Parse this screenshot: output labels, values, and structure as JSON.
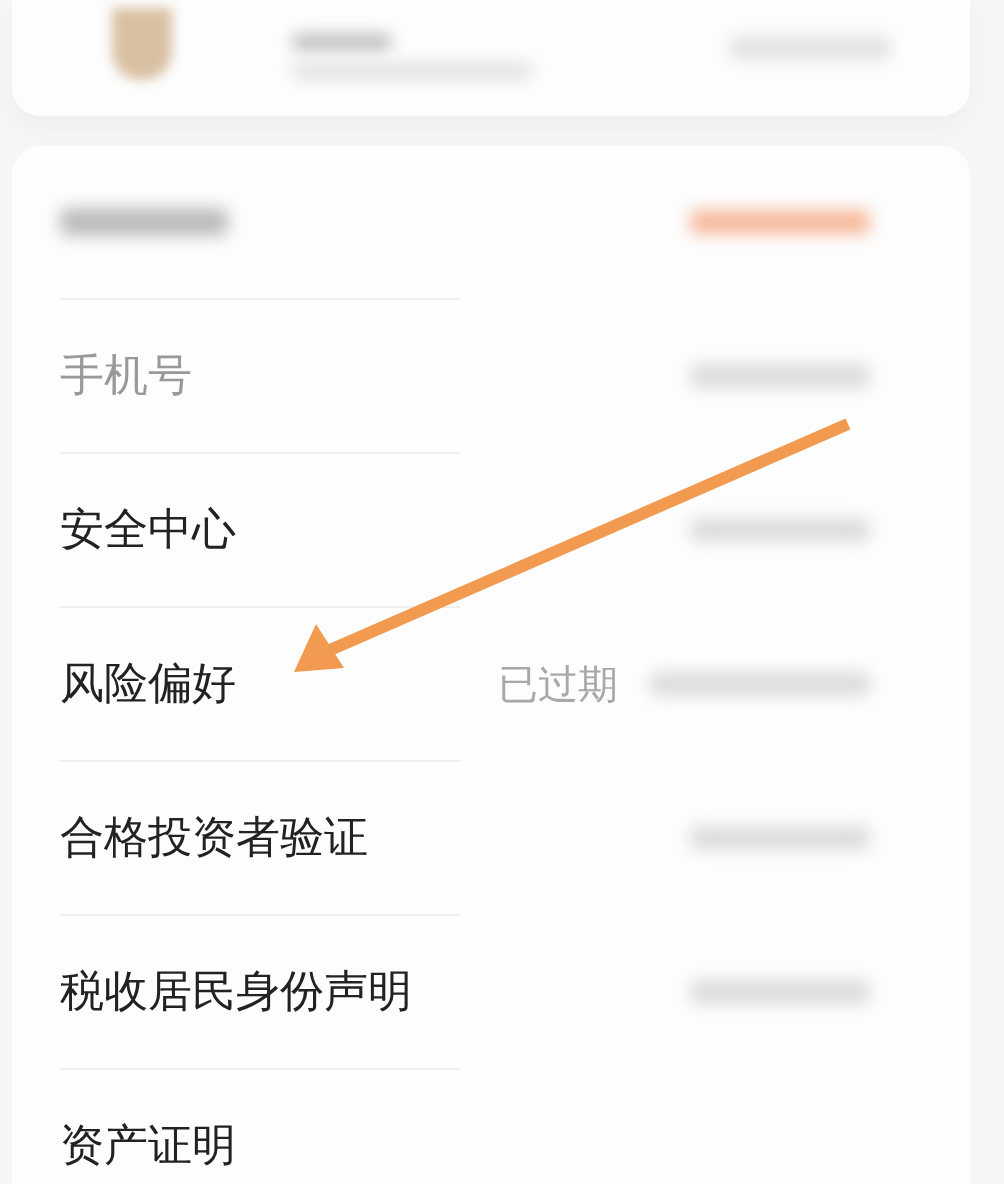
{
  "profile_card": {
    "avatar": true
  },
  "rows": [
    {
      "kind": "blurred",
      "accent": true
    },
    {
      "kind": "text",
      "label": "手机号",
      "blurred": true
    },
    {
      "kind": "text",
      "label": "安全中心",
      "blurred": false
    },
    {
      "kind": "text",
      "label": "风险偏好",
      "blurred": false,
      "status": "已过期"
    },
    {
      "kind": "text",
      "label": "合格投资者验证",
      "blurred": false
    },
    {
      "kind": "text",
      "label": "税收居民身份声明",
      "blurred": false
    },
    {
      "kind": "text",
      "label": "资产证明",
      "blurred": false
    }
  ],
  "annotation": {
    "kind": "arrow"
  }
}
